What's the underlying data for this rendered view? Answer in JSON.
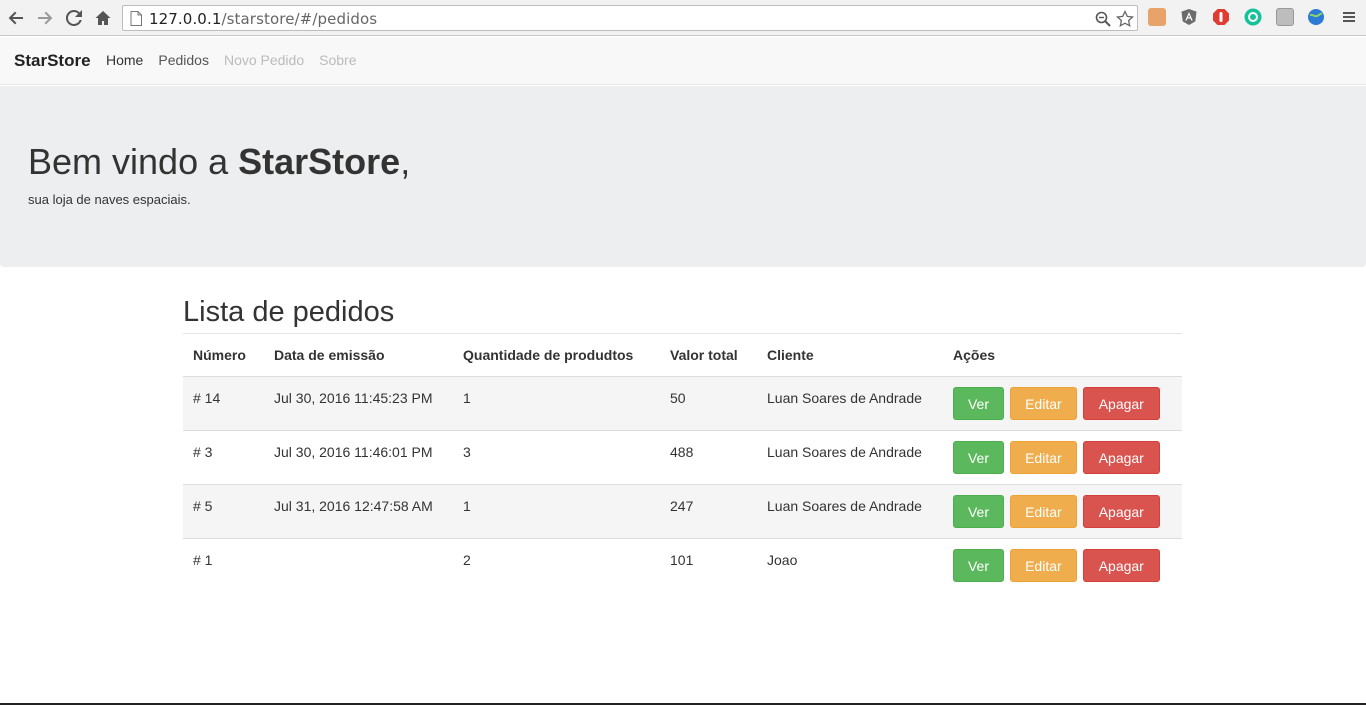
{
  "browser": {
    "url_host": "127.0.0.1",
    "url_path": "/starstore/#/pedidos",
    "icons": [
      "back-icon",
      "forward-icon",
      "reload-icon",
      "home-icon",
      "page-icon",
      "zoom-icon",
      "star-icon",
      "menu-icon"
    ]
  },
  "navbar": {
    "brand": "StarStore",
    "links": [
      {
        "label": "Home"
      },
      {
        "label": "Pedidos"
      },
      {
        "label": "Novo Pedido"
      },
      {
        "label": "Sobre"
      }
    ]
  },
  "jumbotron": {
    "title_prefix": "Bem vindo a ",
    "title_brand": "StarStore",
    "title_suffix": ",",
    "subtitle": "sua loja de naves espaciais."
  },
  "orders": {
    "heading": "Lista de pedidos",
    "columns": [
      "Número",
      "Data de emissão",
      "Quantidade de produdtos",
      "Valor total",
      "Cliente",
      "Ações"
    ],
    "rows": [
      {
        "numero": "# 14",
        "data": "Jul 30, 2016 11:45:23 PM",
        "quantidade": "1",
        "valor": "50",
        "cliente": "Luan Soares de Andrade"
      },
      {
        "numero": "# 3",
        "data": "Jul 30, 2016 11:46:01 PM",
        "quantidade": "3",
        "valor": "488",
        "cliente": "Luan Soares de Andrade"
      },
      {
        "numero": "# 5",
        "data": "Jul 31, 2016 12:47:58 AM",
        "quantidade": "1",
        "valor": "247",
        "cliente": "Luan Soares de Andrade"
      },
      {
        "numero": "# 1",
        "data": "",
        "quantidade": "2",
        "valor": "101",
        "cliente": "Joao"
      }
    ],
    "actions": {
      "view": "Ver",
      "edit": "Editar",
      "delete": "Apagar"
    }
  },
  "colors": {
    "success": "#5cb85c",
    "warning": "#f0ad4e",
    "danger": "#d9534f",
    "jumbotron_bg": "#eceeef"
  }
}
